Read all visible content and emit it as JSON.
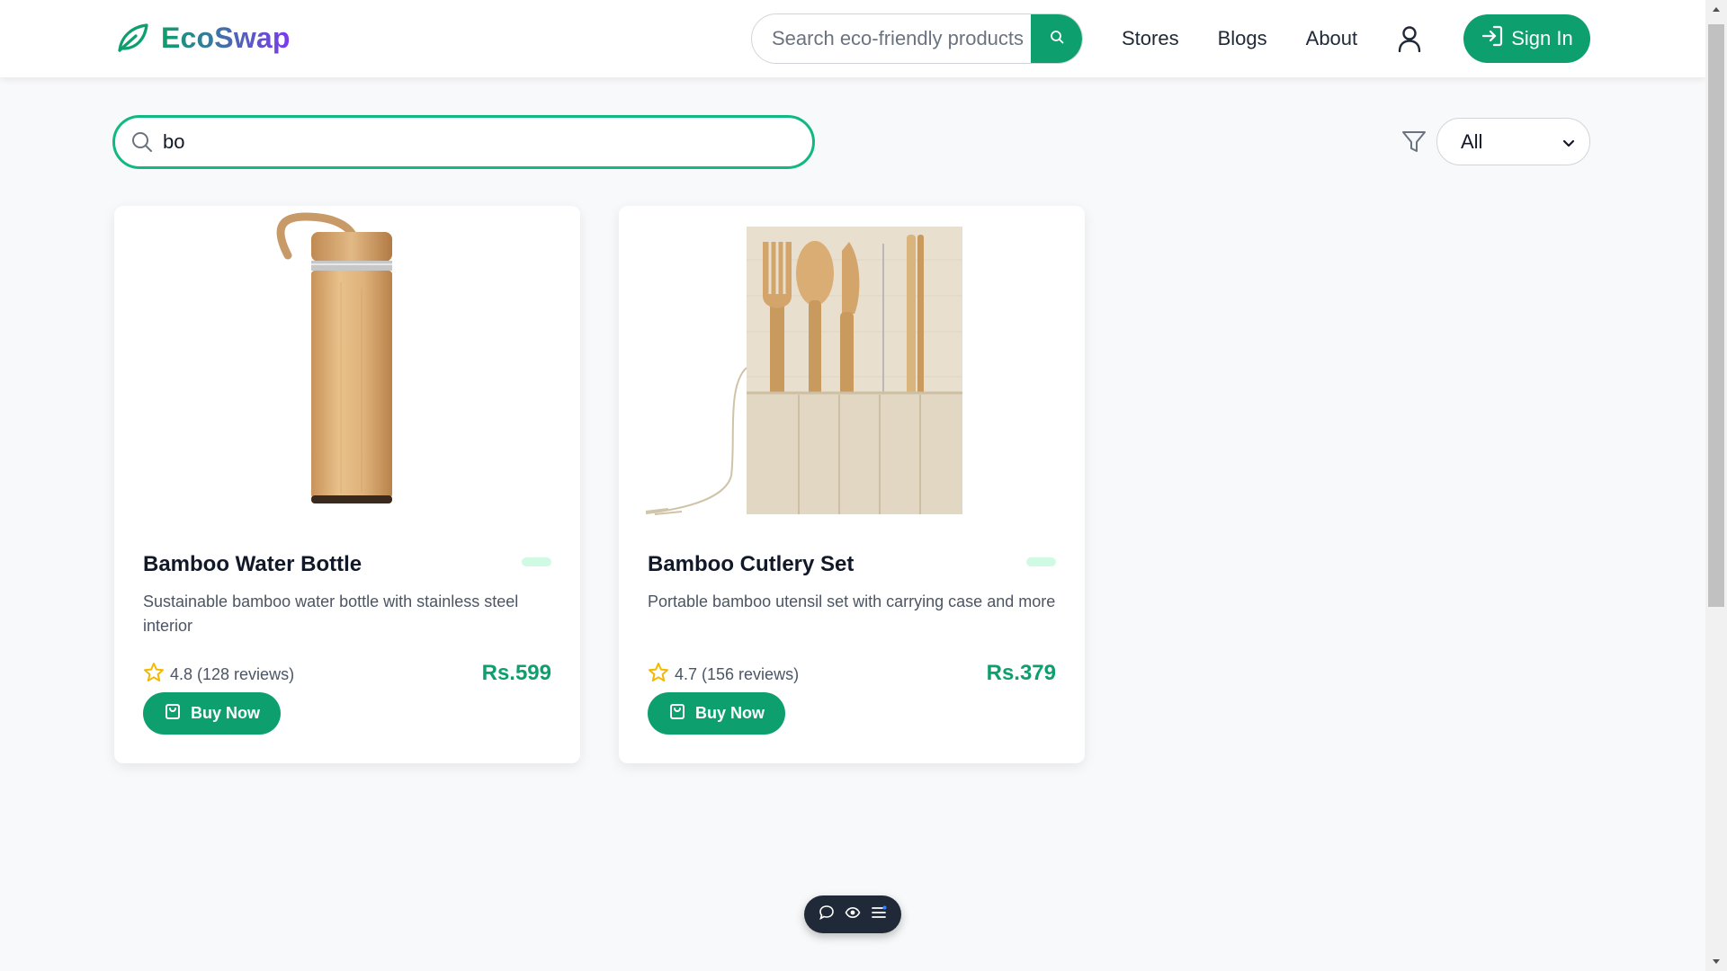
{
  "header": {
    "logo_text": "EcoSwap",
    "search_placeholder": "Search eco-friendly products",
    "nav": [
      "Stores",
      "Blogs",
      "About"
    ],
    "signin_label": "Sign In"
  },
  "filters": {
    "search_value": "bo",
    "category_selected": "All"
  },
  "products": [
    {
      "title": "Bamboo Water Bottle",
      "description": "Sustainable bamboo water bottle with stainless steel interior",
      "rating": "4.8 (128 reviews)",
      "price": "Rs.599",
      "buy_label": "Buy Now"
    },
    {
      "title": "Bamboo Cutlery Set",
      "description": "Portable bamboo utensil set with carrying case and more",
      "rating": "4.7 (156 reviews)",
      "price": "Rs.379",
      "buy_label": "Buy Now"
    }
  ],
  "colors": {
    "brand_green": "#0e9f6e",
    "brand_purple": "#7c3aed",
    "search_border": "#10b981"
  },
  "icons": [
    "leaf-icon",
    "search-icon",
    "user-icon",
    "sign-in-icon",
    "filter-icon",
    "chevron-down-icon",
    "star-icon",
    "shopping-bag-icon",
    "chat-icon",
    "eye-icon",
    "menu-icon"
  ]
}
